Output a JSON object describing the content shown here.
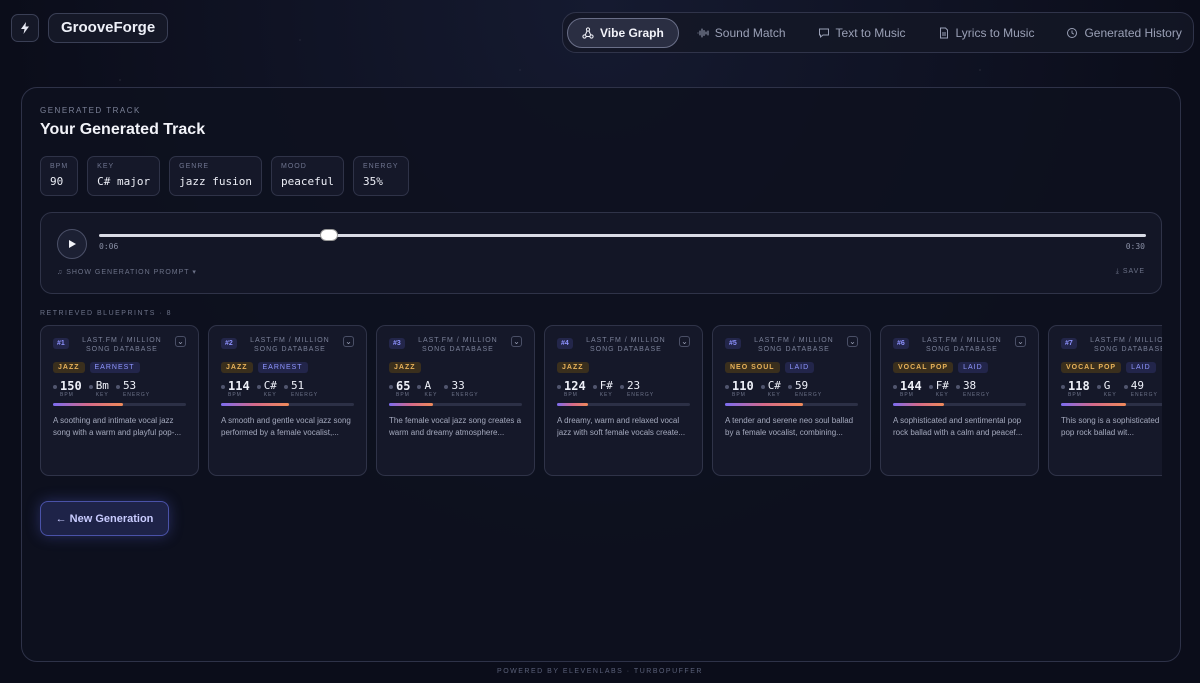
{
  "app": {
    "brand": "GrooveForge"
  },
  "nav": [
    {
      "label": "Vibe Graph",
      "icon": "graph-icon",
      "active": true
    },
    {
      "label": "Sound Match",
      "icon": "waveform-icon",
      "active": false
    },
    {
      "label": "Text to Music",
      "icon": "message-icon",
      "active": false
    },
    {
      "label": "Lyrics to Music",
      "icon": "document-icon",
      "active": false
    },
    {
      "label": "Generated History",
      "icon": "history-icon",
      "active": false
    }
  ],
  "panel": {
    "eyebrow": "GENERATED TRACK",
    "title": "Your Generated Track",
    "stats": [
      {
        "label": "BPM",
        "value": "90"
      },
      {
        "label": "KEY",
        "value": "C# major"
      },
      {
        "label": "GENRE",
        "value": "jazz fusion"
      },
      {
        "label": "MOOD",
        "value": "peaceful"
      },
      {
        "label": "ENERGY",
        "value": "35%"
      }
    ]
  },
  "player": {
    "current_time": "0:06",
    "total_time": "0:30",
    "progress": 0.22,
    "prompt_link": "SHOW GENERATION PROMPT",
    "save_label": "SAVE"
  },
  "blueprints": {
    "header": "RETRIEVED BLUEPRINTS · 8",
    "metric_labels": {
      "bpm": "BPM",
      "key": "KEY",
      "energy": "ENERGY"
    },
    "items": [
      {
        "rank": "#1",
        "source": "LAST.FM / MILLION SONG DATABASE",
        "genre": "JAZZ",
        "mood": "EARNEST",
        "bpm": "150",
        "key": "Bm",
        "energy": "53",
        "energy_level": 0.53,
        "desc": "A soothing and intimate vocal jazz song with a warm and playful pop-..."
      },
      {
        "rank": "#2",
        "source": "LAST.FM / MILLION SONG DATABASE",
        "genre": "JAZZ",
        "mood": "EARNEST",
        "bpm": "114",
        "key": "C#",
        "energy": "51",
        "energy_level": 0.51,
        "desc": "A smooth and gentle vocal jazz song performed by a female vocalist,..."
      },
      {
        "rank": "#3",
        "source": "LAST.FM / MILLION SONG DATABASE",
        "genre": "JAZZ",
        "mood": "",
        "bpm": "65",
        "key": "A",
        "energy": "33",
        "energy_level": 0.33,
        "desc": "The female vocal jazz song creates a warm and dreamy atmosphere..."
      },
      {
        "rank": "#4",
        "source": "LAST.FM / MILLION SONG DATABASE",
        "genre": "JAZZ",
        "mood": "",
        "bpm": "124",
        "key": "F#",
        "energy": "23",
        "energy_level": 0.23,
        "desc": "A dreamy, warm and relaxed vocal jazz with soft female vocals create..."
      },
      {
        "rank": "#5",
        "source": "LAST.FM / MILLION SONG DATABASE",
        "genre": "NEO SOUL",
        "mood": "LAID",
        "bpm": "110",
        "key": "C#",
        "energy": "59",
        "energy_level": 0.59,
        "desc": "A tender and serene neo soul ballad by a female vocalist, combining..."
      },
      {
        "rank": "#6",
        "source": "LAST.FM / MILLION SONG DATABASE",
        "genre": "VOCAL POP",
        "mood": "LAID",
        "bpm": "144",
        "key": "F#",
        "energy": "38",
        "energy_level": 0.38,
        "desc": "A sophisticated and sentimental pop rock ballad with a calm and peacef..."
      },
      {
        "rank": "#7",
        "source": "LAST.FM / MILLION SONG DATABASE",
        "genre": "VOCAL POP",
        "mood": "LAID",
        "bpm": "118",
        "key": "G",
        "energy": "49",
        "energy_level": 0.49,
        "desc": "This song is a sophisticated relaxing pop rock ballad wit..."
      }
    ]
  },
  "new_generation_label": "← New Generation",
  "footer": "POWERED BY ELEVENLABS · TURBOPUFFER"
}
